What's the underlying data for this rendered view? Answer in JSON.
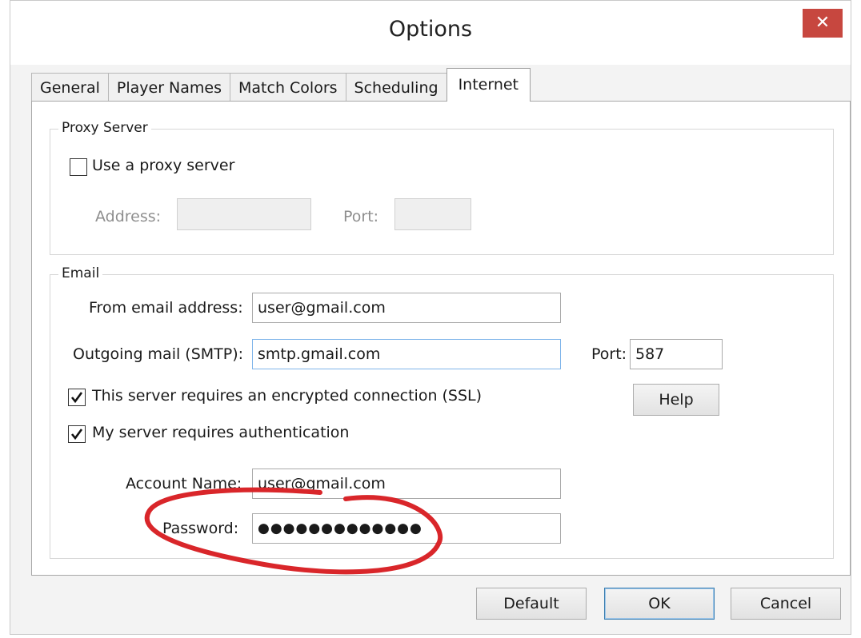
{
  "window": {
    "title": "Options",
    "close_glyph": "✕"
  },
  "tabs": [
    {
      "label": "General"
    },
    {
      "label": "Player Names"
    },
    {
      "label": "Match Colors"
    },
    {
      "label": "Scheduling"
    },
    {
      "label": "Internet"
    }
  ],
  "proxy": {
    "group_label": "Proxy Server",
    "use_proxy_label": "Use a proxy server",
    "use_proxy_checked": false,
    "address_label": "Address:",
    "address_value": "",
    "port_label": "Port:",
    "port_value": ""
  },
  "email": {
    "group_label": "Email",
    "from_label": "From email address:",
    "from_value": "user@gmail.com",
    "smtp_label": "Outgoing mail (SMTP):",
    "smtp_value": "smtp.gmail.com",
    "port_label": "Port:",
    "port_value": "587",
    "ssl_label": "This server requires an encrypted connection (SSL)",
    "ssl_checked": true,
    "help_label": "Help",
    "auth_label": "My server requires authentication",
    "auth_checked": true,
    "account_label": "Account Name:",
    "account_value": "user@gmail.com",
    "password_label": "Password:",
    "password_value": "●●●●●●●●●●●●●"
  },
  "buttons": {
    "default_label": "Default",
    "ok_label": "OK",
    "cancel_label": "Cancel"
  },
  "colors": {
    "close": "#c7473f",
    "annotation": "#d9262a",
    "focus": "#7eb4ea"
  },
  "icons": {
    "check": "check-icon",
    "close": "close-icon"
  }
}
